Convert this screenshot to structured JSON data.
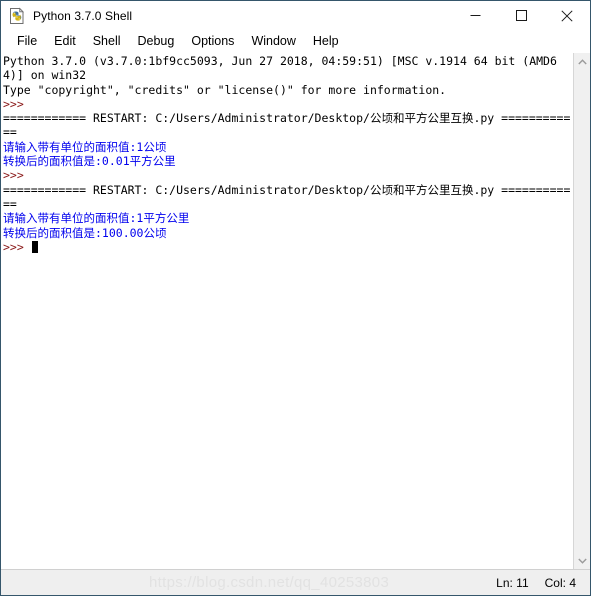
{
  "window": {
    "title": "Python 3.7.0 Shell",
    "icon": "python-idle-icon",
    "controls": {
      "minimize": "minimize-icon",
      "maximize": "maximize-icon",
      "close": "close-icon"
    }
  },
  "menubar": {
    "items": [
      {
        "label": "File"
      },
      {
        "label": "Edit"
      },
      {
        "label": "Shell"
      },
      {
        "label": "Debug"
      },
      {
        "label": "Options"
      },
      {
        "label": "Window"
      },
      {
        "label": "Help"
      }
    ]
  },
  "console": {
    "lines": [
      {
        "text": "Python 3.7.0 (v3.7.0:1bf9cc5093, Jun 27 2018, 04:59:51) [MSC v.1914 64 bit (AMD64)] on win32",
        "color": "black"
      },
      {
        "text": "Type \"copyright\", \"credits\" or \"license()\" for more information.",
        "color": "black"
      },
      {
        "text": ">>> ",
        "color": "prompt"
      },
      {
        "text": "============ RESTART: C:/Users/Administrator/Desktop/公顷和平方公里互换.py ============",
        "color": "black"
      },
      {
        "text": "请输入带有单位的面积值:1公顷",
        "color": "blue"
      },
      {
        "text": "转换后的面积值是:0.01平方公里",
        "color": "blue"
      },
      {
        "text": ">>> ",
        "color": "prompt"
      },
      {
        "text": "============ RESTART: C:/Users/Administrator/Desktop/公顷和平方公里互换.py ============",
        "color": "black"
      },
      {
        "text": "请输入带有单位的面积值:1平方公里",
        "color": "blue"
      },
      {
        "text": "转换后的面积值是:100.00公顷",
        "color": "blue"
      },
      {
        "text": ">>> ",
        "color": "prompt",
        "cursor": true
      }
    ]
  },
  "scrollbar": {
    "up_arrow": "chevron-up-icon",
    "down_arrow": "chevron-down-icon"
  },
  "statusbar": {
    "line_label": "Ln: 11",
    "col_label": "Col: 4"
  },
  "watermark": {
    "text": "https://blog.csdn.net/qq_40253803"
  },
  "colors": {
    "prompt": "#8b1a1a",
    "output_blue": "#0000ee",
    "window_border": "#35566b",
    "statusbar_bg": "#efefef",
    "scrollbar_bg": "#f0f0f0"
  }
}
